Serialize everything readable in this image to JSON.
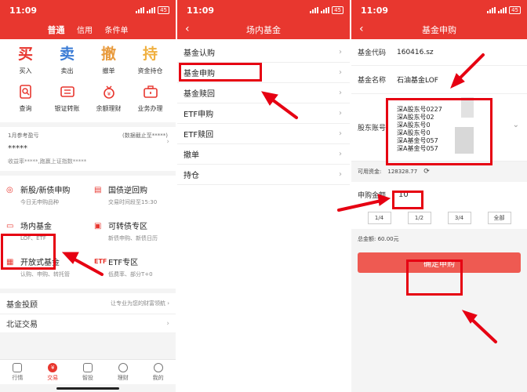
{
  "status": {
    "time": "11:09",
    "battery": "45"
  },
  "panel1": {
    "tabs": [
      "普通",
      "信用",
      "条件单"
    ],
    "actions_row1": [
      {
        "glyph": "买",
        "label": "买入",
        "color": "#e8372f"
      },
      {
        "glyph": "卖",
        "label": "卖出",
        "color": "#3a7bd5"
      },
      {
        "glyph": "撤",
        "label": "撤单",
        "color": "#e89a3c"
      },
      {
        "glyph": "持",
        "label": "资金持仓",
        "color": "#f0b040"
      }
    ],
    "actions_row2": [
      {
        "icon": "search-doc-icon",
        "label": "查询"
      },
      {
        "icon": "bank-transfer-icon",
        "label": "银证转账"
      },
      {
        "icon": "money-bag-icon",
        "label": "余额理财"
      },
      {
        "icon": "briefcase-icon",
        "label": "业务办理"
      }
    ],
    "account": {
      "period": "1月参考盈亏",
      "note": "(数据截止至*****)",
      "masked": "*****",
      "yield": "收益率*****,跑赢上证指数*****"
    },
    "services": [
      {
        "title": "新股/新债申购",
        "sub": "今日无申购品种"
      },
      {
        "title": "国债逆回购",
        "sub": "交易时间段至15:30"
      },
      {
        "title": "场内基金",
        "sub": "LOF、ETF"
      },
      {
        "title": "可转债专区",
        "sub": "新债申购、新债日历"
      },
      {
        "title": "开放式基金",
        "sub": "认购、申购、转托管"
      },
      {
        "title": "ETF专区",
        "sub": "低费率、部分T+0"
      }
    ],
    "invest": {
      "title": "基金投顾",
      "sub": "让专业为您的财富领航"
    },
    "beizheng": "北证交易",
    "tabbar": [
      "行情",
      "交易",
      "智投",
      "理财",
      "我的"
    ]
  },
  "panel2": {
    "title": "场内基金",
    "items": [
      "基金认购",
      "基金申购",
      "基金赎回",
      "ETF申购",
      "ETF赎回",
      "撤单",
      "持仓"
    ]
  },
  "panel3": {
    "title": "基金申购",
    "code_label": "基金代码",
    "code": "160416.sz",
    "name_label": "基金名称",
    "name": "石油基金LOF",
    "holder_label": "股东账号",
    "holder_accounts": [
      "深A股东号0227",
      "深A股东号02",
      "深A股东号0",
      "深A股东号0",
      "深A基金号057",
      "深A基金号057"
    ],
    "avail_label": "可用资金:",
    "avail": "128328.77",
    "amount_label": "申购金额",
    "amount": "10",
    "fractions": [
      "1/4",
      "1/2",
      "3/4",
      "全部"
    ],
    "total": "总金额: 60.00元",
    "submit": "确定申购"
  }
}
